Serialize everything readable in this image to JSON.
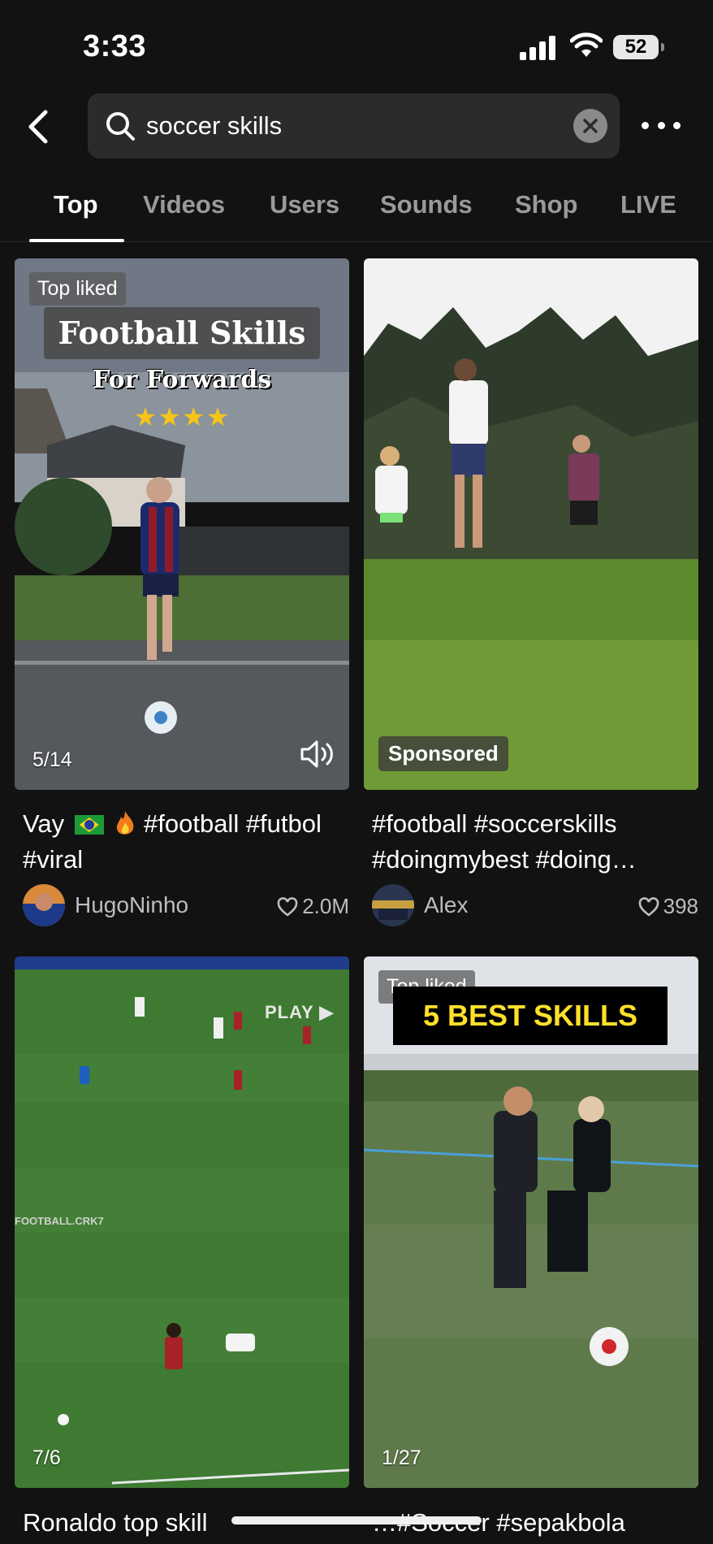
{
  "status_bar": {
    "time": "3:33",
    "battery": "52"
  },
  "search": {
    "query": "soccer skills"
  },
  "tabs": [
    {
      "label": "Top",
      "active": true
    },
    {
      "label": "Videos"
    },
    {
      "label": "Users"
    },
    {
      "label": "Sounds"
    },
    {
      "label": "Shop"
    },
    {
      "label": "LIVE"
    }
  ],
  "results": [
    {
      "badge": "Top liked",
      "overlay_title": "Football Skills",
      "overlay_sub": "For Forwards",
      "overlay_stars": "★★★★",
      "counter": "5/14",
      "caption_prefix": "Vay",
      "caption_suffix": "#football #futbol #viral",
      "author": "HugoNinho",
      "likes": "2.0M",
      "icons": [
        "brazil-flag-icon",
        "fire-icon",
        "sound-icon"
      ]
    },
    {
      "badge": "Sponsored",
      "caption": "#football #soccerskills #doingmybest #doing…",
      "author": "Alex",
      "likes": "398"
    },
    {
      "counter": "7/6",
      "overlay_play": "PLAY ▶",
      "watermark": "FOOTBALL.CRK7",
      "caption": "Ronaldo top skill"
    },
    {
      "badge": "Top liked",
      "overlay_title": "5 BEST SKILLS",
      "counter": "1/27",
      "caption": "…#Soccer #sepakbola"
    }
  ],
  "colors": {
    "background": "#121212",
    "accent_yellow": "#ffe02a",
    "text_secondary": "#bdbdbd"
  }
}
